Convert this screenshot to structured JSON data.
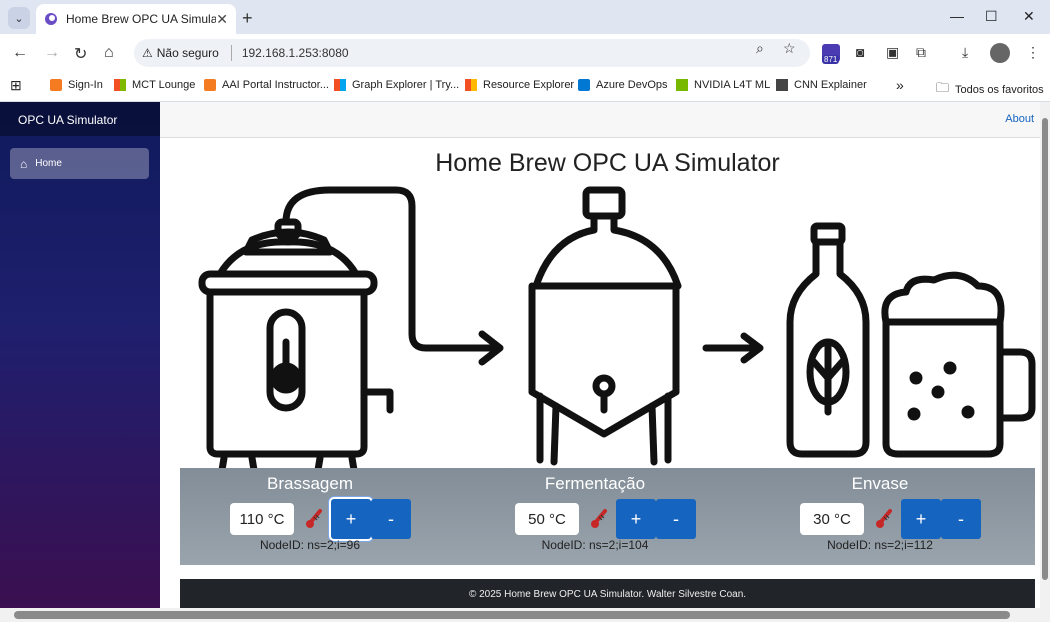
{
  "browser": {
    "tab_title": "Home Brew OPC UA Simulator",
    "security_label": "Não seguro",
    "url": "192.168.1.253:8080",
    "extension_badge": "871"
  },
  "bookmarks": [
    {
      "label": "Sign-In",
      "color": "#f47b20"
    },
    {
      "label": "MCT Lounge",
      "color": "#00a4ef"
    },
    {
      "label": "AAI Portal Instructor...",
      "color": "#f47b20"
    },
    {
      "label": "Graph Explorer | Try...",
      "color": "#00a4ef"
    },
    {
      "label": "Resource Explorer",
      "color": "#00a4ef"
    },
    {
      "label": "Azure DevOps",
      "color": "#0078d4"
    },
    {
      "label": "NVIDIA L4T ML",
      "color": "#76b900"
    },
    {
      "label": "CNN Explainer",
      "color": "#444444"
    }
  ],
  "bookmarks_more": "»",
  "bookmarks_folder": "Todos os favoritos",
  "app": {
    "brand": "OPC UA Simulator",
    "nav_home": "Home",
    "about": "About",
    "title": "Home Brew OPC UA Simulator",
    "footer": "© 2025 Home Brew OPC UA Simulator. Walter Silvestre Coan."
  },
  "stages": [
    {
      "name": "Brassagem",
      "temperature": "110 °C",
      "node_id": "NodeID: ns=2;i=96",
      "plus": "+",
      "minus": "-"
    },
    {
      "name": "Fermentação",
      "temperature": "50 °C",
      "node_id": "NodeID: ns=2;i=104",
      "plus": "+",
      "minus": "-"
    },
    {
      "name": "Envase",
      "temperature": "30 °C",
      "node_id": "NodeID: ns=2;i=112",
      "plus": "+",
      "minus": "-"
    }
  ],
  "colors": {
    "accent": "#1565c0",
    "panel": "#8f99a2",
    "footer": "#212529",
    "sidebar_top": "#0f1a5c",
    "sidebar_bottom": "#3b0f50"
  }
}
